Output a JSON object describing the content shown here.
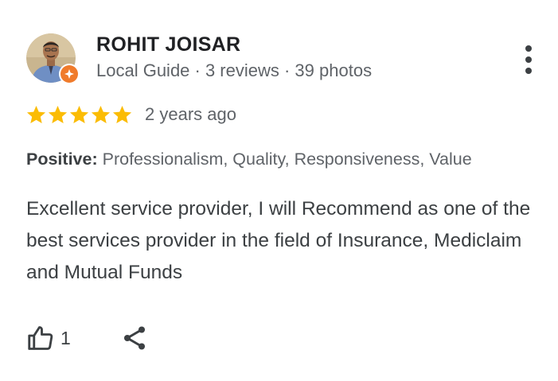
{
  "reviewer": {
    "name": "ROHIT JOISAR",
    "meta": "Local Guide · 3 reviews · 39 photos",
    "avatar_icon": "profile-photo",
    "badge_icon": "local-guide-badge-icon",
    "badge_color": "#f07b2b"
  },
  "menu": {
    "icon": "more-vertical-icon"
  },
  "rating": {
    "stars": 5,
    "max_stars": 5,
    "star_color": "#fbbc04",
    "date": "2 years ago"
  },
  "positive": {
    "label": "Positive:",
    "value": "Professionalism, Quality, Responsiveness, Value"
  },
  "review": {
    "text": "Excellent service provider, I will Recommend as one of the best services provider in the field of Insurance, Mediclaim and Mutual Funds"
  },
  "actions": {
    "like_count": "1",
    "like_icon": "thumbs-up-icon",
    "share_icon": "share-icon"
  }
}
